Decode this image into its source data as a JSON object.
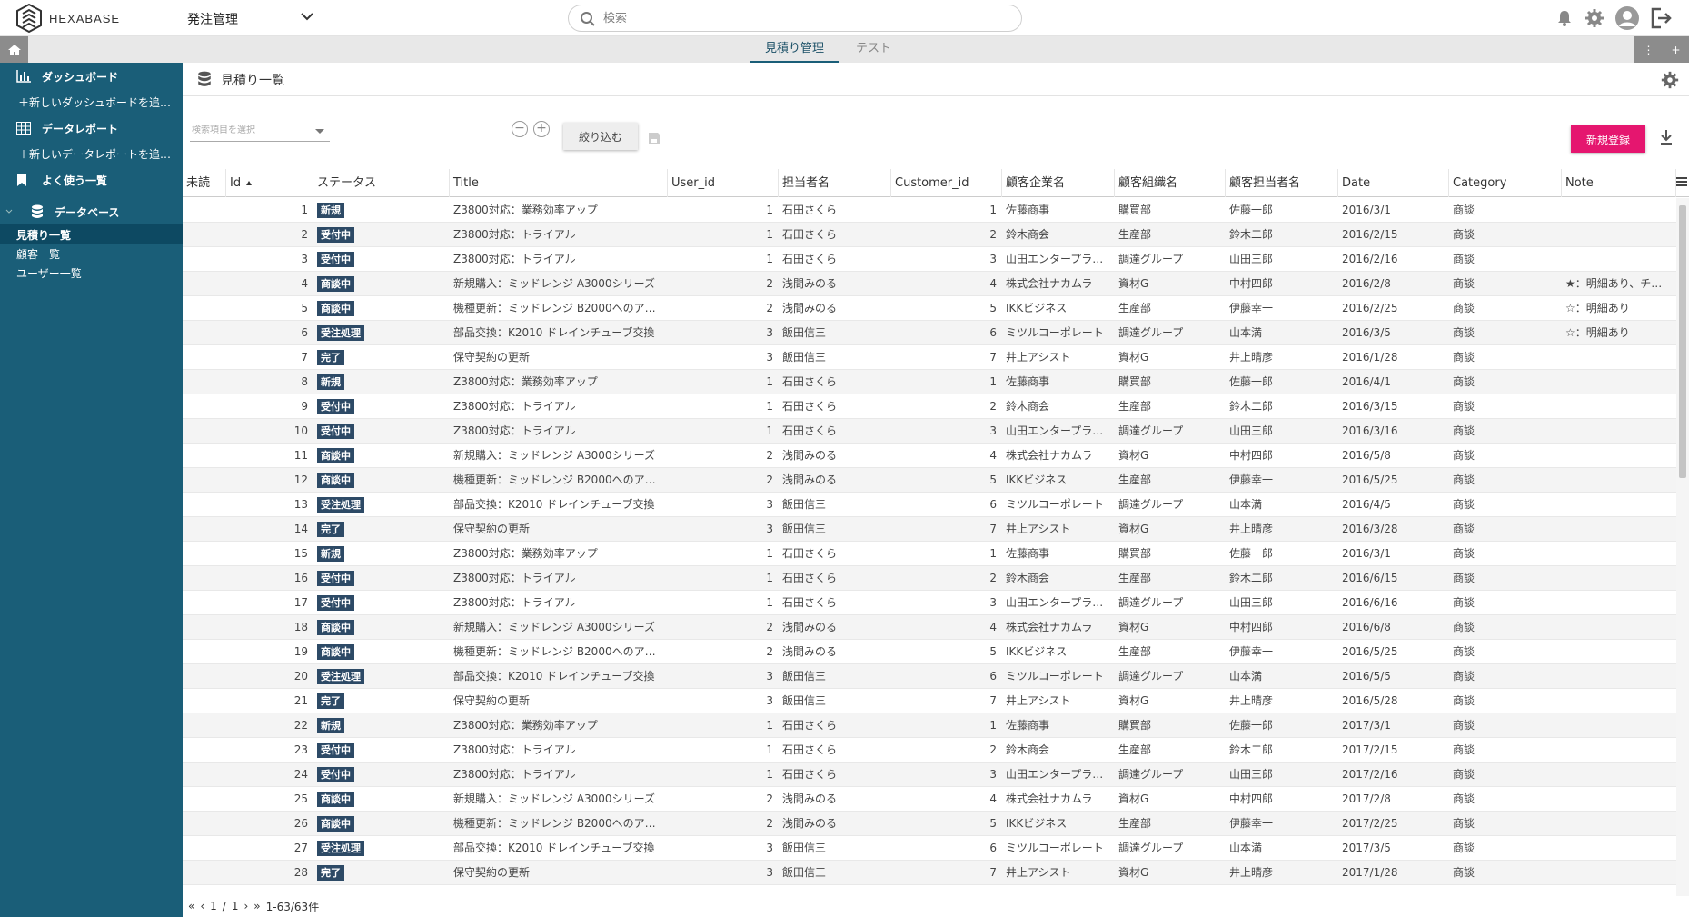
{
  "header": {
    "logo_text": "HEXABASE",
    "app_name": "発注管理",
    "search_placeholder": "検索"
  },
  "tabs": [
    {
      "label": "見積り管理",
      "active": true
    },
    {
      "label": "テスト",
      "active": false
    }
  ],
  "sidebar": {
    "items": [
      {
        "label": "ダッシュボード",
        "icon": "bar-chart-icon",
        "type": "section"
      },
      {
        "label": "＋新しいダッシュボードを追…",
        "type": "add"
      },
      {
        "label": "データレポート",
        "icon": "table-icon",
        "type": "section"
      },
      {
        "label": "＋新しいデータレポートを追…",
        "type": "add"
      },
      {
        "label": "よく使う一覧",
        "icon": "bookmark-icon",
        "type": "section"
      },
      {
        "label": "データベース",
        "icon": "database-icon",
        "type": "section"
      },
      {
        "label": "見積り一覧",
        "type": "sub",
        "active": true
      },
      {
        "label": "顧客一覧",
        "type": "sub"
      },
      {
        "label": "ユーザー一覧",
        "type": "sub"
      }
    ]
  },
  "page": {
    "title": "見積り一覧",
    "filter_placeholder": "検索項目を選択",
    "apply_label": "絞り込む",
    "new_label": "新規登録"
  },
  "table": {
    "columns": [
      "未読",
      "Id",
      "ステータス",
      "Title",
      "User_id",
      "担当者名",
      "Customer_id",
      "顧客企業名",
      "顧客組織名",
      "顧客担当者名",
      "Date",
      "Category",
      "Note"
    ],
    "rows": [
      [
        "",
        "1",
        "新規",
        "Z3800対応：業務効率アップ",
        "1",
        "石田さくら",
        "1",
        "佐藤商事",
        "購買部",
        "佐藤一郎",
        "2016/3/1",
        "商談",
        ""
      ],
      [
        "",
        "2",
        "受付中",
        "Z3800対応：トライアル",
        "1",
        "石田さくら",
        "2",
        "鈴木商会",
        "生産部",
        "鈴木二郎",
        "2016/2/15",
        "商談",
        ""
      ],
      [
        "",
        "3",
        "受付中",
        "Z3800対応：トライアル",
        "1",
        "石田さくら",
        "3",
        "山田エンタープラ…",
        "調達グループ",
        "山田三郎",
        "2016/2/16",
        "商談",
        ""
      ],
      [
        "",
        "4",
        "商談中",
        "新規購入：ミッドレンジ A3000シリーズ",
        "2",
        "浅間みのる",
        "4",
        "株式会社ナカムラ",
        "資材G",
        "中村四郎",
        "2016/2/8",
        "商談",
        "★：明細あり、チ…"
      ],
      [
        "",
        "5",
        "商談中",
        "機種更新：ミッドレンジ B2000へのア…",
        "2",
        "浅間みのる",
        "5",
        "IKKビジネス",
        "生産部",
        "伊藤幸一",
        "2016/2/25",
        "商談",
        "☆：明細あり"
      ],
      [
        "",
        "6",
        "受注処理",
        "部品交換：K2010 ドレインチューブ交換",
        "3",
        "飯田信三",
        "6",
        "ミツルコーポレート",
        "調達グループ",
        "山本満",
        "2016/3/5",
        "商談",
        "☆：明細あり"
      ],
      [
        "",
        "7",
        "完了",
        "保守契約の更新",
        "3",
        "飯田信三",
        "7",
        "井上アシスト",
        "資材G",
        "井上晴彦",
        "2016/1/28",
        "商談",
        ""
      ],
      [
        "",
        "8",
        "新規",
        "Z3800対応：業務効率アップ",
        "1",
        "石田さくら",
        "1",
        "佐藤商事",
        "購買部",
        "佐藤一郎",
        "2016/4/1",
        "商談",
        ""
      ],
      [
        "",
        "9",
        "受付中",
        "Z3800対応：トライアル",
        "1",
        "石田さくら",
        "2",
        "鈴木商会",
        "生産部",
        "鈴木二郎",
        "2016/3/15",
        "商談",
        ""
      ],
      [
        "",
        "10",
        "受付中",
        "Z3800対応：トライアル",
        "1",
        "石田さくら",
        "3",
        "山田エンタープラ…",
        "調達グループ",
        "山田三郎",
        "2016/3/16",
        "商談",
        ""
      ],
      [
        "",
        "11",
        "商談中",
        "新規購入：ミッドレンジ A3000シリーズ",
        "2",
        "浅間みのる",
        "4",
        "株式会社ナカムラ",
        "資材G",
        "中村四郎",
        "2016/5/8",
        "商談",
        ""
      ],
      [
        "",
        "12",
        "商談中",
        "機種更新：ミッドレンジ B2000へのア…",
        "2",
        "浅間みのる",
        "5",
        "IKKビジネス",
        "生産部",
        "伊藤幸一",
        "2016/5/25",
        "商談",
        ""
      ],
      [
        "",
        "13",
        "受注処理",
        "部品交換：K2010 ドレインチューブ交換",
        "3",
        "飯田信三",
        "6",
        "ミツルコーポレート",
        "調達グループ",
        "山本満",
        "2016/4/5",
        "商談",
        ""
      ],
      [
        "",
        "14",
        "完了",
        "保守契約の更新",
        "3",
        "飯田信三",
        "7",
        "井上アシスト",
        "資材G",
        "井上晴彦",
        "2016/3/28",
        "商談",
        ""
      ],
      [
        "",
        "15",
        "新規",
        "Z3800対応：業務効率アップ",
        "1",
        "石田さくら",
        "1",
        "佐藤商事",
        "購買部",
        "佐藤一郎",
        "2016/3/1",
        "商談",
        ""
      ],
      [
        "",
        "16",
        "受付中",
        "Z3800対応：トライアル",
        "1",
        "石田さくら",
        "2",
        "鈴木商会",
        "生産部",
        "鈴木二郎",
        "2016/6/15",
        "商談",
        ""
      ],
      [
        "",
        "17",
        "受付中",
        "Z3800対応：トライアル",
        "1",
        "石田さくら",
        "3",
        "山田エンタープラ…",
        "調達グループ",
        "山田三郎",
        "2016/6/16",
        "商談",
        ""
      ],
      [
        "",
        "18",
        "商談中",
        "新規購入：ミッドレンジ A3000シリーズ",
        "2",
        "浅間みのる",
        "4",
        "株式会社ナカムラ",
        "資材G",
        "中村四郎",
        "2016/6/8",
        "商談",
        ""
      ],
      [
        "",
        "19",
        "商談中",
        "機種更新：ミッドレンジ B2000へのア…",
        "2",
        "浅間みのる",
        "5",
        "IKKビジネス",
        "生産部",
        "伊藤幸一",
        "2016/5/25",
        "商談",
        ""
      ],
      [
        "",
        "20",
        "受注処理",
        "部品交換：K2010 ドレインチューブ交換",
        "3",
        "飯田信三",
        "6",
        "ミツルコーポレート",
        "調達グループ",
        "山本満",
        "2016/5/5",
        "商談",
        ""
      ],
      [
        "",
        "21",
        "完了",
        "保守契約の更新",
        "3",
        "飯田信三",
        "7",
        "井上アシスト",
        "資材G",
        "井上晴彦",
        "2016/5/28",
        "商談",
        ""
      ],
      [
        "",
        "22",
        "新規",
        "Z3800対応：業務効率アップ",
        "1",
        "石田さくら",
        "1",
        "佐藤商事",
        "購買部",
        "佐藤一郎",
        "2017/3/1",
        "商談",
        ""
      ],
      [
        "",
        "23",
        "受付中",
        "Z3800対応：トライアル",
        "1",
        "石田さくら",
        "2",
        "鈴木商会",
        "生産部",
        "鈴木二郎",
        "2017/2/15",
        "商談",
        ""
      ],
      [
        "",
        "24",
        "受付中",
        "Z3800対応：トライアル",
        "1",
        "石田さくら",
        "3",
        "山田エンタープラ…",
        "調達グループ",
        "山田三郎",
        "2017/2/16",
        "商談",
        ""
      ],
      [
        "",
        "25",
        "商談中",
        "新規購入：ミッドレンジ A3000シリーズ",
        "2",
        "浅間みのる",
        "4",
        "株式会社ナカムラ",
        "資材G",
        "中村四郎",
        "2017/2/8",
        "商談",
        ""
      ],
      [
        "",
        "26",
        "商談中",
        "機種更新：ミッドレンジ B2000へのア…",
        "2",
        "浅間みのる",
        "5",
        "IKKビジネス",
        "生産部",
        "伊藤幸一",
        "2017/2/25",
        "商談",
        ""
      ],
      [
        "",
        "27",
        "受注処理",
        "部品交換：K2010 ドレインチューブ交換",
        "3",
        "飯田信三",
        "6",
        "ミツルコーポレート",
        "調達グループ",
        "山本満",
        "2017/3/5",
        "商談",
        ""
      ],
      [
        "",
        "28",
        "完了",
        "保守契約の更新",
        "3",
        "飯田信三",
        "7",
        "井上アシスト",
        "資材G",
        "井上晴彦",
        "2017/1/28",
        "商談",
        ""
      ]
    ]
  },
  "pager": {
    "page": "1",
    "sep": "/",
    "total_pages": "1",
    "range": "1-63/63件"
  },
  "colors": {
    "sidebar_bg": "#1a5e78",
    "new_button": "#e5166f",
    "badge_bg": "#2d4a66"
  }
}
